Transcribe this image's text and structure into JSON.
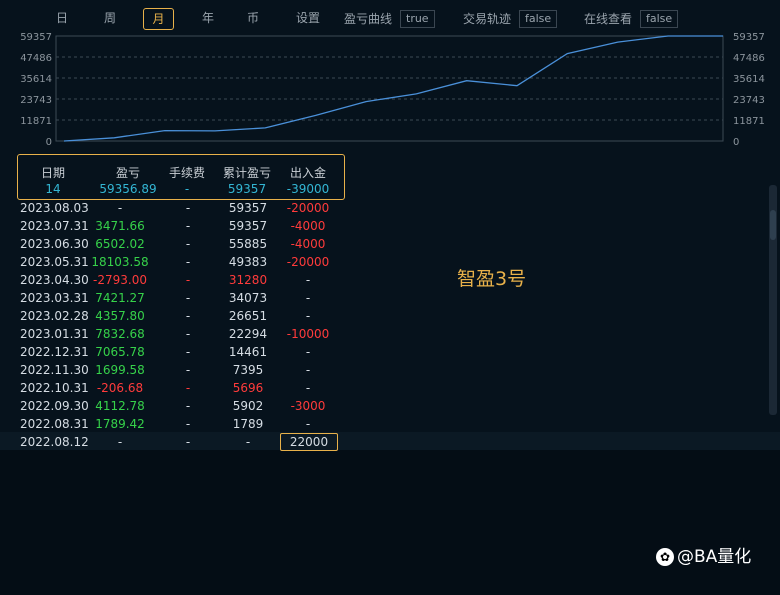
{
  "tabs": [
    {
      "label": "日",
      "active": false
    },
    {
      "label": "周",
      "active": false
    },
    {
      "label": "月",
      "active": true
    },
    {
      "label": "年",
      "active": false
    },
    {
      "label": "币",
      "active": false
    },
    {
      "label": "设置",
      "active": false
    }
  ],
  "options": {
    "profit_curve_label": "盈亏曲线",
    "profit_curve_value": "true",
    "trade_path_label": "交易轨迹",
    "trade_path_value": "false",
    "online_view_label": "在线查看",
    "online_view_value": "false"
  },
  "chart_data": {
    "type": "line",
    "yticks": [
      0,
      11871,
      23743,
      35614,
      47486,
      59357
    ],
    "ylim": [
      0,
      59357
    ],
    "x": [
      "2022.08.12",
      "2022.08.31",
      "2022.09.30",
      "2022.10.31",
      "2022.11.30",
      "2022.12.31",
      "2023.01.31",
      "2023.02.28",
      "2023.03.31",
      "2023.04.30",
      "2023.05.31",
      "2023.06.30",
      "2023.07.31",
      "2023.08.03"
    ],
    "values": [
      0,
      1789,
      5902,
      5696,
      7395,
      14461,
      22294,
      26651,
      34073,
      31280,
      49383,
      55885,
      59357,
      59357
    ],
    "line_color": "#4a90d9",
    "grid": true
  },
  "summary": {
    "headers": [
      "日期",
      "盈亏",
      "手续费",
      "累计盈亏",
      "出入金"
    ],
    "values": [
      "14",
      "59356.89",
      "-",
      "59357",
      "-39000"
    ]
  },
  "rows": [
    {
      "date": "2023.08.03",
      "pnl": "-",
      "fee": "-",
      "cum": "59357",
      "flow": "-20000",
      "pnl_c": "white",
      "fee_c": "white",
      "cum_c": "white",
      "flow_c": "red"
    },
    {
      "date": "2023.07.31",
      "pnl": "3471.66",
      "fee": "-",
      "cum": "59357",
      "flow": "-4000",
      "pnl_c": "green",
      "fee_c": "white",
      "cum_c": "white",
      "flow_c": "red"
    },
    {
      "date": "2023.06.30",
      "pnl": "6502.02",
      "fee": "-",
      "cum": "55885",
      "flow": "-4000",
      "pnl_c": "green",
      "fee_c": "white",
      "cum_c": "white",
      "flow_c": "red"
    },
    {
      "date": "2023.05.31",
      "pnl": "18103.58",
      "fee": "-",
      "cum": "49383",
      "flow": "-20000",
      "pnl_c": "green",
      "fee_c": "white",
      "cum_c": "white",
      "flow_c": "red"
    },
    {
      "date": "2023.04.30",
      "pnl": "-2793.00",
      "fee": "-",
      "cum": "31280",
      "flow": "-",
      "pnl_c": "red",
      "fee_c": "red",
      "cum_c": "red",
      "flow_c": "white"
    },
    {
      "date": "2023.03.31",
      "pnl": "7421.27",
      "fee": "-",
      "cum": "34073",
      "flow": "-",
      "pnl_c": "green",
      "fee_c": "white",
      "cum_c": "white",
      "flow_c": "white"
    },
    {
      "date": "2023.02.28",
      "pnl": "4357.80",
      "fee": "-",
      "cum": "26651",
      "flow": "-",
      "pnl_c": "green",
      "fee_c": "white",
      "cum_c": "white",
      "flow_c": "white"
    },
    {
      "date": "2023.01.31",
      "pnl": "7832.68",
      "fee": "-",
      "cum": "22294",
      "flow": "-10000",
      "pnl_c": "green",
      "fee_c": "white",
      "cum_c": "white",
      "flow_c": "red"
    },
    {
      "date": "2022.12.31",
      "pnl": "7065.78",
      "fee": "-",
      "cum": "14461",
      "flow": "-",
      "pnl_c": "green",
      "fee_c": "white",
      "cum_c": "white",
      "flow_c": "white"
    },
    {
      "date": "2022.11.30",
      "pnl": "1699.58",
      "fee": "-",
      "cum": "7395",
      "flow": "-",
      "pnl_c": "green",
      "fee_c": "white",
      "cum_c": "white",
      "flow_c": "white"
    },
    {
      "date": "2022.10.31",
      "pnl": "-206.68",
      "fee": "-",
      "cum": "5696",
      "flow": "-",
      "pnl_c": "red",
      "fee_c": "red",
      "cum_c": "red",
      "flow_c": "white"
    },
    {
      "date": "2022.09.30",
      "pnl": "4112.78",
      "fee": "-",
      "cum": "5902",
      "flow": "-3000",
      "pnl_c": "green",
      "fee_c": "white",
      "cum_c": "white",
      "flow_c": "red"
    },
    {
      "date": "2022.08.31",
      "pnl": "1789.42",
      "fee": "-",
      "cum": "1789",
      "flow": "-",
      "pnl_c": "green",
      "fee_c": "white",
      "cum_c": "white",
      "flow_c": "white"
    },
    {
      "date": "2022.08.12",
      "pnl": "-",
      "fee": "-",
      "cum": "-",
      "flow": "22000",
      "pnl_c": "white",
      "fee_c": "white",
      "cum_c": "white",
      "flow_c": "white"
    }
  ],
  "product_name": "智盈3号",
  "watermark": "@BA量化",
  "colors": {
    "accent": "#e8b14a",
    "positive": "#36d24a",
    "negative": "#ff3b3b",
    "info": "#33b6d4"
  }
}
